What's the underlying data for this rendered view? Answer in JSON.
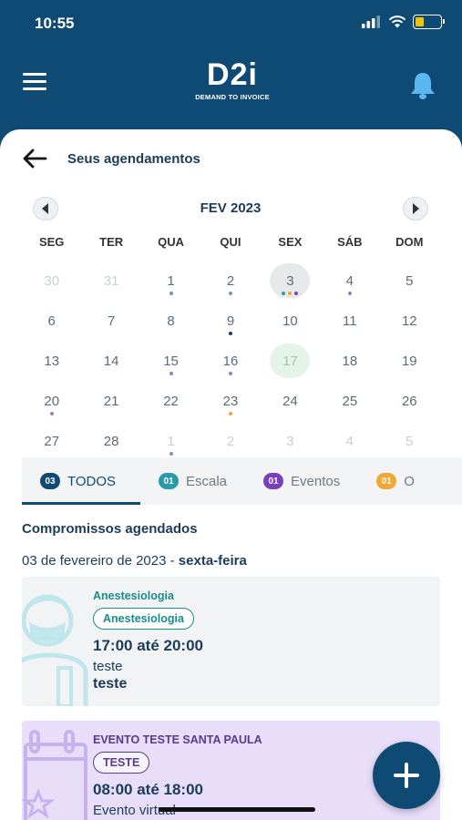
{
  "status_bar": {
    "time": "10:55"
  },
  "app_bar": {
    "logo_mark": "D2i",
    "logo_subtitle": "DEMAND TO INVOICE"
  },
  "header": {
    "title": "Seus agendamentos"
  },
  "calendar": {
    "month": "FEV 2023",
    "weekdays": [
      "SEG",
      "TER",
      "QUA",
      "QUI",
      "SEX",
      "SÁB",
      "DOM"
    ],
    "days": [
      {
        "d": "30",
        "muted": true,
        "dots": []
      },
      {
        "d": "31",
        "muted": true,
        "dots": []
      },
      {
        "d": "1",
        "dots": [
          "#7f8fb5"
        ]
      },
      {
        "d": "2",
        "dots": [
          "#7f8fb5"
        ]
      },
      {
        "d": "3",
        "selected": true,
        "dots": [
          "#2a9aa8",
          "#f0a830",
          "#7a3fbf"
        ]
      },
      {
        "d": "4",
        "dots": [
          "#7f8fb5"
        ]
      },
      {
        "d": "5",
        "dots": []
      },
      {
        "d": "6",
        "dots": []
      },
      {
        "d": "7",
        "dots": []
      },
      {
        "d": "8",
        "dots": []
      },
      {
        "d": "9",
        "dots": [
          "#1d3c5a"
        ]
      },
      {
        "d": "10",
        "dots": []
      },
      {
        "d": "11",
        "dots": []
      },
      {
        "d": "12",
        "dots": []
      },
      {
        "d": "13",
        "dots": []
      },
      {
        "d": "14",
        "dots": []
      },
      {
        "d": "15",
        "dots": [
          "#7f8fb5"
        ]
      },
      {
        "d": "16",
        "dots": [
          "#7f8fb5"
        ]
      },
      {
        "d": "17",
        "today": true,
        "dots": []
      },
      {
        "d": "18",
        "dots": []
      },
      {
        "d": "19",
        "dots": []
      },
      {
        "d": "20",
        "dots": [
          "#7f8fb5"
        ]
      },
      {
        "d": "21",
        "dots": []
      },
      {
        "d": "22",
        "dots": []
      },
      {
        "d": "23",
        "dots": [
          "#f0a830"
        ]
      },
      {
        "d": "24",
        "dots": []
      },
      {
        "d": "25",
        "dots": []
      },
      {
        "d": "26",
        "dots": []
      },
      {
        "d": "27",
        "dots": []
      },
      {
        "d": "28",
        "dots": []
      },
      {
        "d": "1",
        "muted": true,
        "dots": [
          "#7f8fb5"
        ]
      },
      {
        "d": "2",
        "muted": true,
        "dots": []
      },
      {
        "d": "3",
        "muted": true,
        "dots": []
      },
      {
        "d": "4",
        "muted": true,
        "dots": []
      },
      {
        "d": "5",
        "muted": true,
        "dots": []
      }
    ]
  },
  "tabs": [
    {
      "count": "03",
      "label": "TODOS",
      "color": "#0f4a74",
      "active": true
    },
    {
      "count": "01",
      "label": "Escala",
      "color": "#2a9aa8"
    },
    {
      "count": "01",
      "label": "Eventos",
      "color": "#7a3fbf"
    },
    {
      "count": "01",
      "label": "O",
      "color": "#f0a830"
    }
  ],
  "section": {
    "title": "Compromissos agendados",
    "date_prefix": "03 de fevereiro de 2023 - ",
    "date_weekday": "sexta-feira"
  },
  "appointments": [
    {
      "kicker": "Anestesiologia",
      "chip": "Anestesiologia",
      "time": "17:00 até 20:00",
      "line1": "teste",
      "line2": "teste",
      "accent": "#1a8c8c"
    },
    {
      "kicker": "EVENTO TESTE SANTA PAULA",
      "chip": "TESTE",
      "time": "08:00 até 18:00",
      "line1": "Evento virtual",
      "accent": "#5b3b8a"
    }
  ]
}
